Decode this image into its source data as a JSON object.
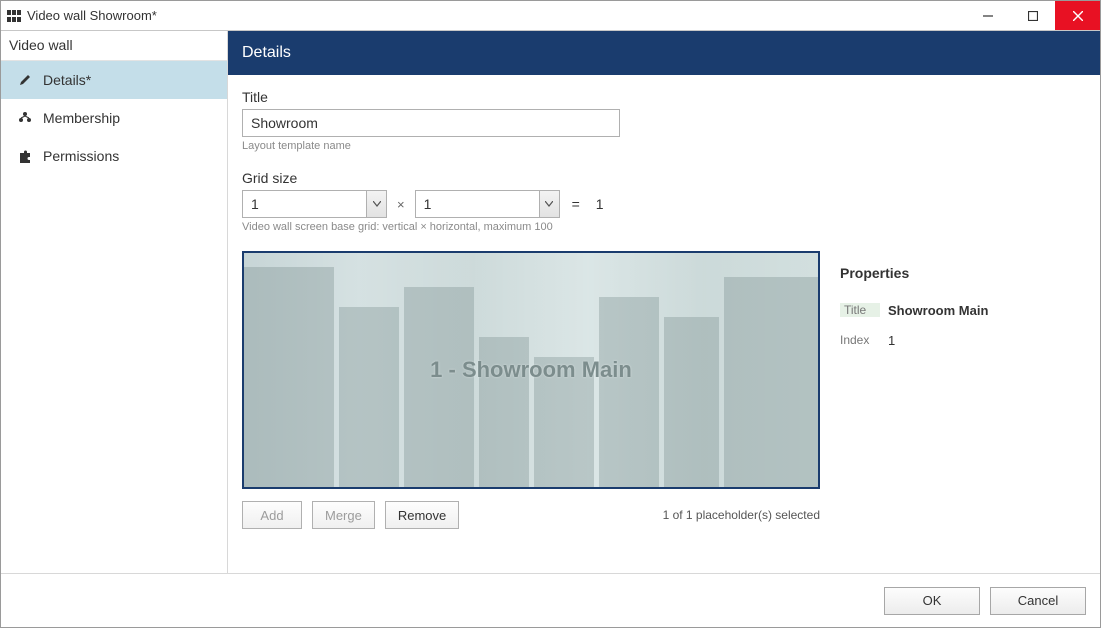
{
  "window": {
    "title": "Video wall Showroom*"
  },
  "sidebar": {
    "title": "Video wall",
    "items": [
      {
        "label": "Details*"
      },
      {
        "label": "Membership"
      },
      {
        "label": "Permissions"
      }
    ]
  },
  "main": {
    "header": "Details",
    "title_label": "Title",
    "title_value": "Showroom",
    "title_help": "Layout template name",
    "grid_label": "Grid size",
    "grid_v": "1",
    "grid_h": "1",
    "grid_times": "×",
    "grid_equals": "=",
    "grid_result": "1",
    "grid_help": "Video wall screen base grid: vertical × horizontal, maximum 100",
    "preview_label": "1 - Showroom Main",
    "buttons": {
      "add": "Add",
      "merge": "Merge",
      "remove": "Remove"
    },
    "status": "1 of 1 placeholder(s) selected"
  },
  "properties": {
    "heading": "Properties",
    "rows": [
      {
        "key": "Title",
        "val": "Showroom Main"
      },
      {
        "key": "Index",
        "val": "1"
      }
    ]
  },
  "footer": {
    "ok": "OK",
    "cancel": "Cancel"
  }
}
